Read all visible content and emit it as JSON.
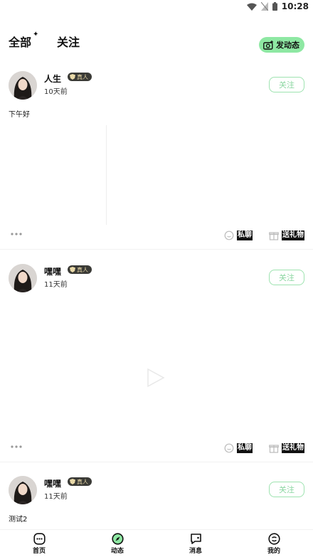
{
  "status_bar": {
    "time": "10:28"
  },
  "header": {
    "tab_all": "全部",
    "tab_follow": "关注",
    "post_button": "发动态"
  },
  "posts": [
    {
      "name": "人生",
      "badge": "真人",
      "time": "10天前",
      "follow_label": "关注",
      "content": "下午好",
      "chat_label": "私聊",
      "gift_label": "送礼物"
    },
    {
      "name": "嘿嘿",
      "badge": "真人",
      "time": "11天前",
      "follow_label": "关注",
      "content": "",
      "chat_label": "私聊",
      "gift_label": "送礼物"
    },
    {
      "name": "嘿嘿",
      "badge": "真人",
      "time": "11天前",
      "follow_label": "关注",
      "content": "测试2"
    }
  ],
  "bottom_nav": [
    {
      "label": "首页",
      "icon": "home-icon"
    },
    {
      "label": "动态",
      "icon": "compass-icon"
    },
    {
      "label": "消息",
      "icon": "message-icon"
    },
    {
      "label": "我的",
      "icon": "profile-icon"
    }
  ],
  "colors": {
    "accent_green": "#8ee8a3",
    "follow_border": "#9ee3b0",
    "badge_bg": "#3a3a36"
  }
}
